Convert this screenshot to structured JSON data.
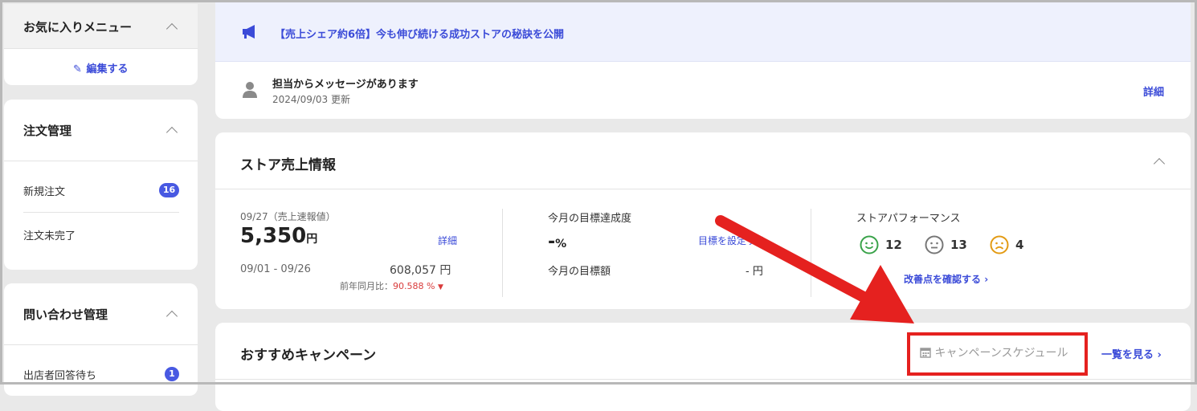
{
  "sidebar": {
    "favorites": {
      "title": "お気に入りメニュー",
      "edit_label": "編集する"
    },
    "orders": {
      "title": "注文管理",
      "items": [
        {
          "label": "新規注文",
          "badge": "16"
        },
        {
          "label": "注文未完了",
          "badge": ""
        }
      ]
    },
    "inquiries": {
      "title": "問い合わせ管理",
      "items": [
        {
          "label": "出店者回答待ち",
          "badge": "1"
        }
      ]
    }
  },
  "announcement": {
    "text": "【売上シェア約6倍】今も伸び続ける成功ストアの秘訣を公開"
  },
  "message": {
    "title": "担当からメッセージがあります",
    "date": "2024/09/03 更新",
    "detail_label": "詳細"
  },
  "sales": {
    "title": "ストア売上情報",
    "date_label": "09/27（売上速報値）",
    "amount": "5,350",
    "amount_unit": "円",
    "detail_label": "詳細",
    "period": "09/01 - 09/26",
    "period_amount": "608,057 円",
    "yoy_label": "前年同月比：",
    "yoy_value": "90.588 %",
    "goal_rate_label": "今月の目標達成度",
    "goal_rate_value": "-",
    "goal_rate_unit": "%",
    "set_goal_label": "目標を設定する",
    "goal_amount_label": "今月の目標額",
    "goal_amount_value": "- 円",
    "performance_title": "ストアパフォーマンス",
    "performance": [
      {
        "icon": "smile-icon",
        "value": "12",
        "color": "#3aa34a"
      },
      {
        "icon": "neutral-face-icon",
        "value": "13",
        "color": "#777777"
      },
      {
        "icon": "frown-icon",
        "value": "4",
        "color": "#e39b14"
      }
    ],
    "improve_label": "改善点を確認する"
  },
  "campaign": {
    "title": "おすすめキャンペーン",
    "schedule_label": "キャンペーンスケジュール",
    "view_all_label": "一覧を見る"
  },
  "colors": {
    "accent": "#3b4bd8",
    "badge": "#4859e2",
    "annotation_red": "#e5211f",
    "banner_bg": "#eef1fd",
    "page_bg": "#e9e9e9"
  }
}
